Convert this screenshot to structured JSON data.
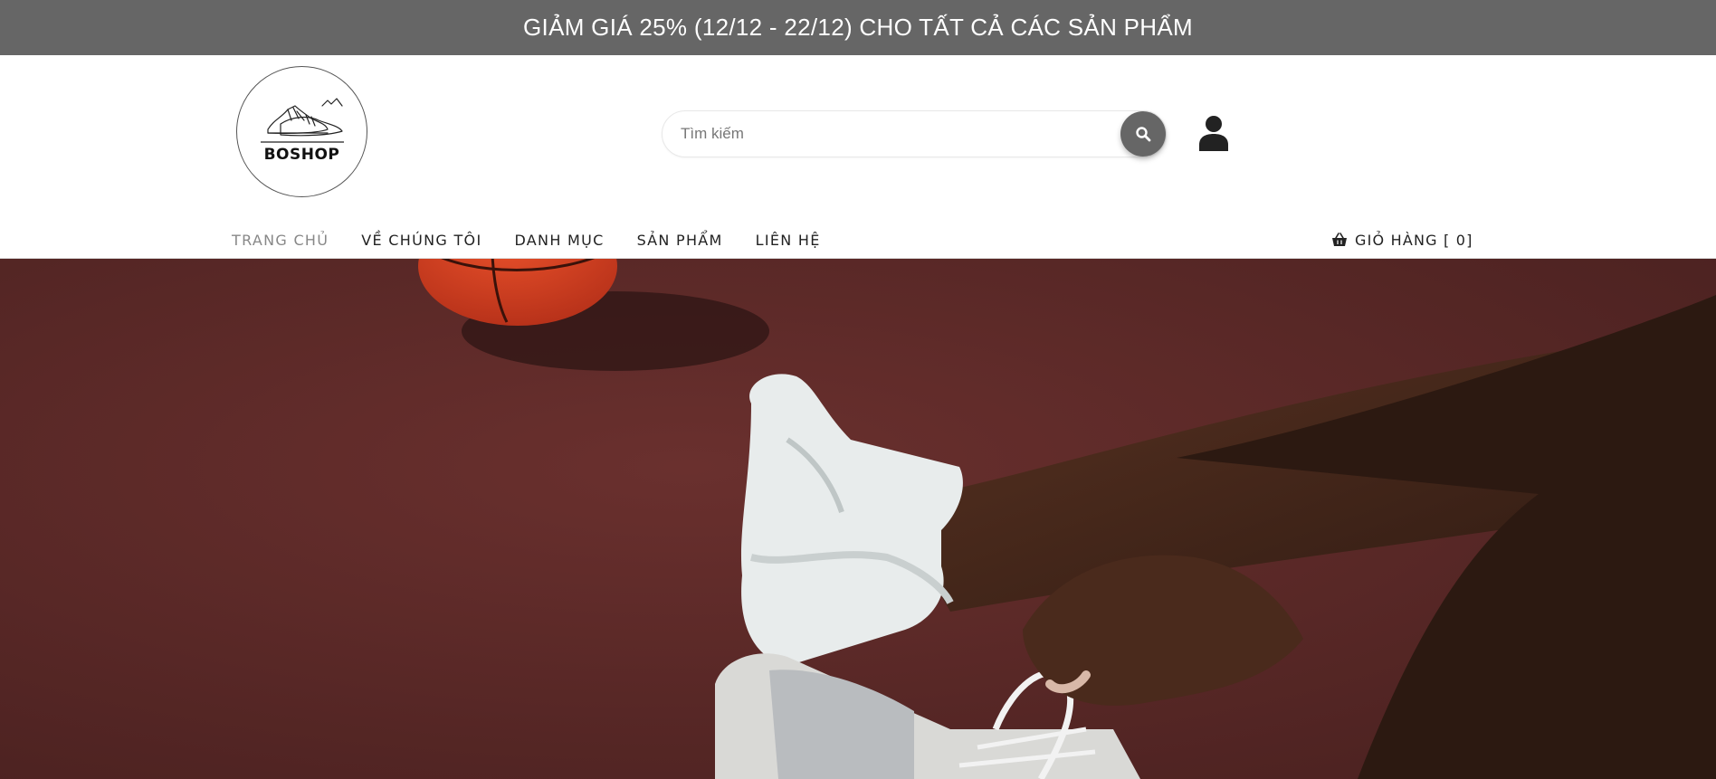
{
  "promo": {
    "text": "GIẢM GIÁ 25% (12/12 - 22/12) CHO TẤT CẢ CÁC SẢN PHẨM"
  },
  "logo": {
    "text": "BOSHOP",
    "icon": "sneakers-logo-icon"
  },
  "search": {
    "placeholder": "Tìm kiếm",
    "value": "",
    "icon": "search-icon"
  },
  "account": {
    "icon": "user-icon"
  },
  "nav": {
    "items": [
      {
        "label": "TRANG CHỦ",
        "active": true
      },
      {
        "label": "VỀ CHÚNG TÔI",
        "active": false
      },
      {
        "label": "DANH MỤC",
        "active": false
      },
      {
        "label": "SẢN PHẨM",
        "active": false
      },
      {
        "label": "LIÊN HỆ",
        "active": false
      }
    ]
  },
  "cart": {
    "label": "GIỎ HÀNG [ 0]",
    "icon": "basket-icon"
  },
  "colors": {
    "promo_bg": "#666666",
    "search_button": "#666666",
    "hero_court": "#5a2a28"
  }
}
